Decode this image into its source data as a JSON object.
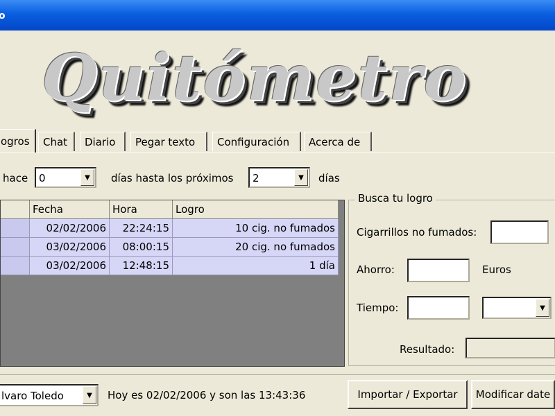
{
  "window": {
    "title": "o"
  },
  "logo": {
    "text": "Quitómetro"
  },
  "tabs": [
    {
      "label": "ogros",
      "active": true
    },
    {
      "label": "Chat"
    },
    {
      "label": "Diario"
    },
    {
      "label": "Pegar texto"
    },
    {
      "label": "Configuración"
    },
    {
      "label": "Acerca de"
    }
  ],
  "filter": {
    "prefix": "hace",
    "from_value": "0",
    "middle": "días hasta los próximos",
    "to_value": "2",
    "suffix": "días"
  },
  "table": {
    "headers": [
      "",
      "Fecha",
      "Hora",
      "Logro"
    ],
    "rows": [
      [
        "",
        "02/02/2006",
        "22:24:15",
        "10 cig. no fumados"
      ],
      [
        "",
        "03/02/2006",
        "08:00:15",
        "20 cig. no fumados"
      ],
      [
        "",
        "03/02/2006",
        "12:48:15",
        "1 día"
      ]
    ]
  },
  "search": {
    "title": "Busca tu logro",
    "cigarettes_label": "Cigarrillos no fumados:",
    "cigarettes_value": "",
    "savings_label": "Ahorro:",
    "savings_value": "",
    "currency": "Euros",
    "time_label": "Tiempo:",
    "time_value": "",
    "time_unit": "",
    "result_label": "Resultado:",
    "result_value": ""
  },
  "status": {
    "user": "lvaro Toledo",
    "message": "Hoy es 02/02/2006 y son las 13:43:36"
  },
  "buttons": {
    "import_export": "Importar / Exportar",
    "modify": "Modificar date"
  },
  "colors": {
    "titlebar": "#0a5fe0",
    "window_bg": "#ece9d8",
    "row_bg": "#d6d6f7",
    "grid_bg": "#808080"
  }
}
